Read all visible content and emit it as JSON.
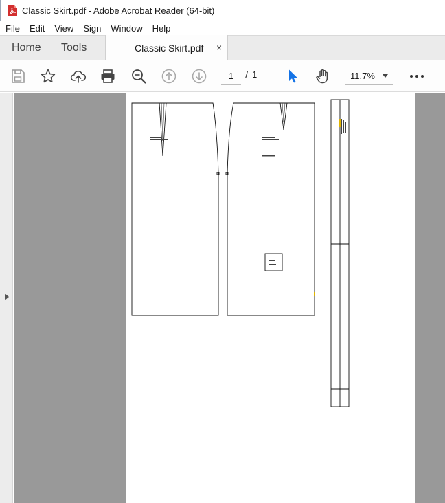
{
  "window": {
    "title": "Classic Skirt.pdf - Adobe Acrobat Reader (64-bit)"
  },
  "menu": [
    "File",
    "Edit",
    "View",
    "Sign",
    "Window",
    "Help"
  ],
  "tabs": {
    "home": "Home",
    "tools": "Tools",
    "document": "Classic Skirt.pdf",
    "close_glyph": "×"
  },
  "toolbar": {
    "icons": [
      "save-icon",
      "bookmark-star-icon",
      "upload-cloud-icon",
      "print-icon",
      "zoom-search-icon",
      "page-up-icon",
      "page-down-icon",
      "select-cursor-icon",
      "hand-tool-icon",
      "more-icon"
    ],
    "current_page": "1",
    "page_separator": "/",
    "total_pages": "1",
    "zoom": "11.7%"
  },
  "colors": {
    "accent": "#1473e6",
    "viewer_bg": "#999999",
    "tabbar_bg": "#ebebeb"
  }
}
